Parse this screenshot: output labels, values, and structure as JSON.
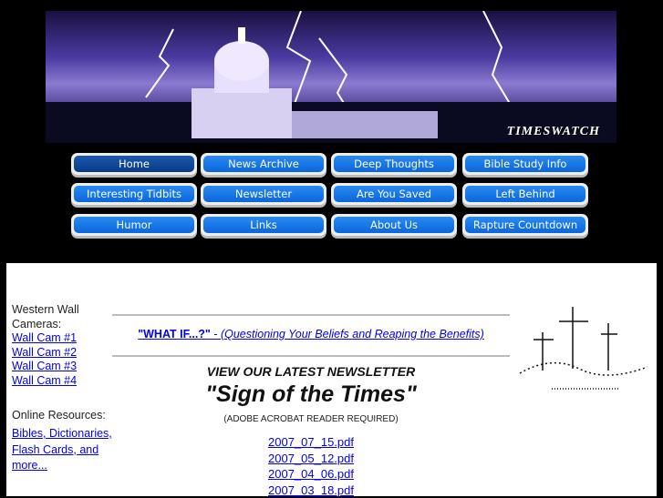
{
  "banner": {
    "brand": "TIMESWATCH"
  },
  "nav": [
    {
      "label": "Home",
      "active": true
    },
    {
      "label": "News Archive"
    },
    {
      "label": "Deep Thoughts"
    },
    {
      "label": "Bible Study Info"
    },
    {
      "label": "Interesting Tidbits"
    },
    {
      "label": "Newsletter"
    },
    {
      "label": "Are You Saved"
    },
    {
      "label": "Left Behind"
    },
    {
      "label": "Humor"
    },
    {
      "label": "Links"
    },
    {
      "label": "About Us"
    },
    {
      "label": "Rapture Countdown"
    }
  ],
  "sidebar": {
    "cams_heading": "Western Wall Cameras:",
    "cams": [
      "Wall Cam #1",
      "Wall Cam #2",
      "Wall Cam #3",
      "Wall Cam #4"
    ],
    "resources_heading": "Online Resources:",
    "resources_link": "Bibles, Dictionaries, Flash Cards, and more..."
  },
  "main": {
    "whatif_title": "\"WHAT IF...?\"",
    "whatif_sep": " - ",
    "whatif_sub": "(Questioning Your Beliefs and Reaping the Benefits)",
    "newsletter_heading": "VIEW OUR LATEST NEWSLETTER",
    "newsletter_title": "\"Sign of the Times\"",
    "newsletter_note": "(ADOBE ACROBAT READER REQUIRED)",
    "pdfs": [
      "2007_07_15.pdf",
      "2007_05_12.pdf",
      "2007_04_06.pdf",
      "2007_03_18.pdf"
    ]
  },
  "colors": {
    "link": "#0000ee",
    "button": "#0a66dd",
    "background": "#000000"
  }
}
